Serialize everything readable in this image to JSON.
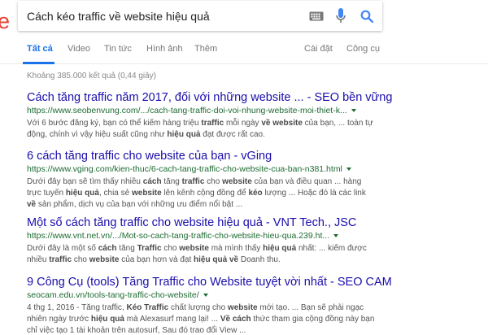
{
  "query": "Cách kéo traffic về website hiệu quả",
  "logo_fragment": "e",
  "colors": {
    "link": "#1a0dab",
    "url": "#1e6b32",
    "active_tab": "#1a73e8",
    "logo": "#ea4335"
  },
  "tabs": [
    {
      "label": "Tất cả",
      "active": true
    },
    {
      "label": "Video"
    },
    {
      "label": "Tin tức"
    },
    {
      "label": "Hình ảnh"
    },
    {
      "label": "Thêm"
    }
  ],
  "tools": {
    "settings": "Cài đặt",
    "tools": "Công cụ"
  },
  "stats": "Khoảng 385.000 kết quả (0,44 giây)",
  "results": [
    {
      "title": "Cách tăng traffic năm 2017, đối với những website ... - SEO bền vững",
      "url": "https://www.seobenvung.com/.../cach-tang-traffic-doi-voi-nhung-website-moi-thiet-k...",
      "snippet": "Với 6 bước đăng ký, bạn có thể kiếm hàng triệu <b>traffic</b> mỗi ngày <b>về website</b> của bạn, ... toàn tự động, chính vì vậy hiệu suất cũng như <b>hiệu quả</b> đạt được rất cao."
    },
    {
      "title": "6 cách tăng traffic cho website của bạn - vGing",
      "url": "https://www.vging.com/kien-thuc/6-cach-tang-traffic-cho-website-cua-ban-n381.html",
      "snippet": "Dưới đây bạn sẽ tìm thấy nhiều <b>cách</b> tăng <b>traffic</b> cho <b>website</b> của bạn và điều quan ... hàng trực tuyến <b>hiệu quả</b>, chia sẻ <b>website</b> lên kênh cộng đồng để <b>kéo</b> lượng ... Hoặc đó là các link <b>về</b> sản phẩm, dịch vụ của bạn với những ưu điểm nổi bật ..."
    },
    {
      "title": "Một số cách tăng traffic cho website hiệu quả - VNT Tech., JSC",
      "url": "https://www.vnt.net.vn/.../Mot-so-cach-tang-traffic-cho-website-hieu-qua.239.ht...",
      "snippet": "Dưới đây là một số <b>cách</b> tăng <b>Traffic</b> cho <b>website</b> mà mình thấy <b>hiệu quả</b> nhất: ... kiếm được nhiều <b>traffic</b> cho <b>website</b> của bạn hơn và đạt <b>hiệu quả về</b> Doanh thu."
    },
    {
      "title": "9 Công Cụ (tools) Tăng Traffic cho Website tuyệt vời nhất - SEO CAM",
      "url": "seocam.edu.vn/tools-tang-traffic-cho-website/",
      "snippet": "4 thg 1, 2016 - Tăng traffic, <b>Kéo Traffic</b> chất lượng cho <b>website</b> mới tạo. ... Bạn sẽ phải ngạc nhiên ngày trước <b>hiệu quả</b> mà Alexasurf mang lại! ... <b>Về cách</b> thức tham gia cộng đồng này bạn chỉ việc tạo 1 tài khoản trên autosurf, Sau đó trao đổi View ..."
    }
  ]
}
